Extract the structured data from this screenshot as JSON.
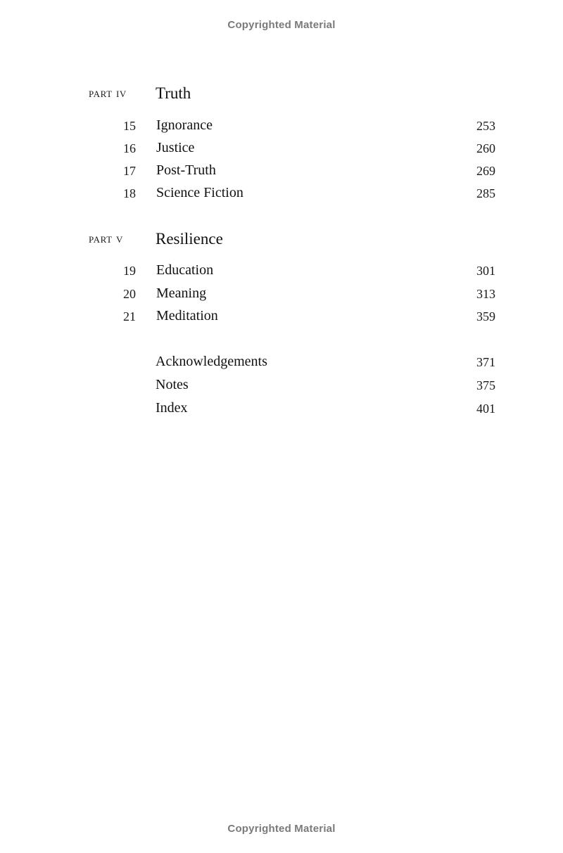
{
  "watermark": {
    "top": "Copyrighted Material",
    "bottom": "Copyrighted Material"
  },
  "toc": {
    "parts": [
      {
        "label": "PART IV",
        "title": "Truth",
        "chapters": [
          {
            "number": "15",
            "title": "Ignorance",
            "page": "253"
          },
          {
            "number": "16",
            "title": "Justice",
            "page": "260"
          },
          {
            "number": "17",
            "title": "Post-Truth",
            "page": "269"
          },
          {
            "number": "18",
            "title": "Science Fiction",
            "page": "285"
          }
        ]
      },
      {
        "label": "PART V",
        "title": "Resilience",
        "chapters": [
          {
            "number": "19",
            "title": "Education",
            "page": "301"
          },
          {
            "number": "20",
            "title": "Meaning",
            "page": "313"
          },
          {
            "number": "21",
            "title": "Meditation",
            "page": "359"
          }
        ]
      }
    ],
    "back_matter": [
      {
        "title": "Acknowledgements",
        "page": "371"
      },
      {
        "title": "Notes",
        "page": "375"
      },
      {
        "title": "Index",
        "page": "401"
      }
    ]
  }
}
